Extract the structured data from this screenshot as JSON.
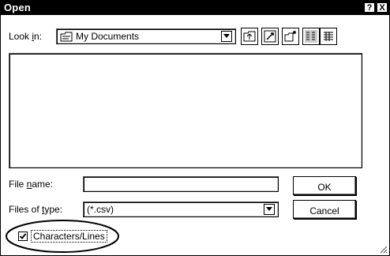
{
  "dialog": {
    "title": "Open",
    "help_label": "?",
    "close_label": "X"
  },
  "look_in": {
    "label_prefix": "Look ",
    "label_mnemonic": "i",
    "label_suffix": "n:",
    "value": "My Documents"
  },
  "toolbar": {
    "up_icon": "up-one-level-icon",
    "desktop_icon": "desktop-icon",
    "new_folder_icon": "new-folder-icon",
    "list_icon": "list-view-icon",
    "details_icon": "details-view-icon"
  },
  "file_name": {
    "label_prefix": "File ",
    "label_mnemonic": "n",
    "label_suffix": "ame:",
    "value": ""
  },
  "file_type": {
    "label_prefix": "Files of ",
    "label_mnemonic": "t",
    "label_suffix": "ype:",
    "value": "(*.csv)"
  },
  "buttons": {
    "ok": "OK",
    "cancel": "Cancel"
  },
  "option": {
    "label": "Characters/Lines",
    "checked": true
  }
}
